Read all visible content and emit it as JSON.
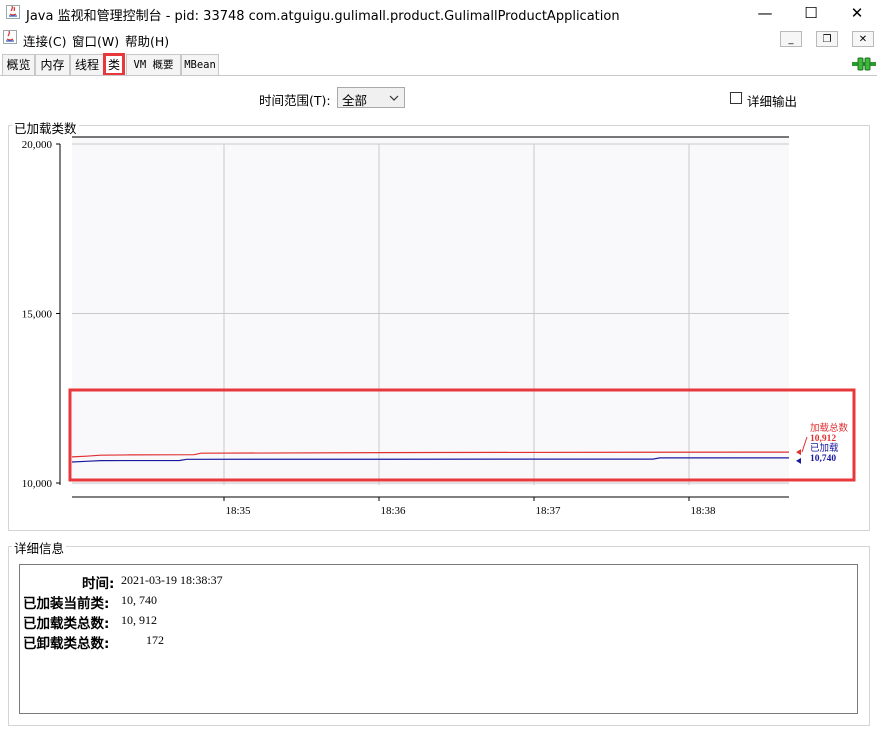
{
  "window": {
    "title": "Java 监视和管理控制台 - pid: 33748 com.atguigu.gulimall.product.GulimallProductApplication",
    "minimize": "—",
    "maximize": "☐",
    "close": "✕"
  },
  "menu": {
    "items": [
      {
        "label": "连接(C)"
      },
      {
        "label": "窗口(W)"
      },
      {
        "label": "帮助(H)"
      }
    ]
  },
  "inner_buttons": {
    "minimize": "_",
    "restore": "❐",
    "close": "✕"
  },
  "tabs": [
    {
      "label": "概览"
    },
    {
      "label": "内存"
    },
    {
      "label": "线程"
    },
    {
      "label": "类"
    },
    {
      "label": "VM 概要"
    },
    {
      "label": "MBean"
    }
  ],
  "active_tab": "类",
  "controls": {
    "time_range_label": "时间范围(T):",
    "time_range_value": "全部",
    "verbose_label": "详细输出"
  },
  "colors": {
    "loaded_total": "#e03030",
    "loaded": "#1a1aa0",
    "highlight": "#e8383b"
  },
  "chart_data": {
    "type": "line",
    "title": "已加载类数",
    "ylim": [
      10000,
      20000
    ],
    "yticks": [
      "20,000",
      "15,000",
      "10,000"
    ],
    "xticks": [
      "18:35",
      "18:36",
      "18:37",
      "18:38"
    ],
    "grid": true,
    "series": [
      {
        "name": "加载总数",
        "value_label": "10,912",
        "points": [
          [
            0,
            10770
          ],
          [
            0.02,
            10790
          ],
          [
            0.04,
            10820
          ],
          [
            0.08,
            10830
          ],
          [
            0.17,
            10835
          ],
          [
            0.18,
            10880
          ],
          [
            0.5,
            10900
          ],
          [
            1,
            10912
          ]
        ]
      },
      {
        "name": "已加载",
        "value_label": "10,740",
        "points": [
          [
            0,
            10620
          ],
          [
            0.02,
            10640
          ],
          [
            0.04,
            10660
          ],
          [
            0.15,
            10665
          ],
          [
            0.16,
            10700
          ],
          [
            0.81,
            10705
          ],
          [
            0.82,
            10740
          ],
          [
            1,
            10740
          ]
        ]
      }
    ]
  },
  "details": {
    "title": "详细信息",
    "rows": [
      {
        "label": "时间:",
        "value": "2021-03-19 18:38:37"
      },
      {
        "label": "已加装当前类:",
        "value": "10, 740"
      },
      {
        "label": "已加载类总数:",
        "value": "10, 912"
      },
      {
        "label": "已卸载类总数:",
        "value": "172"
      }
    ]
  }
}
